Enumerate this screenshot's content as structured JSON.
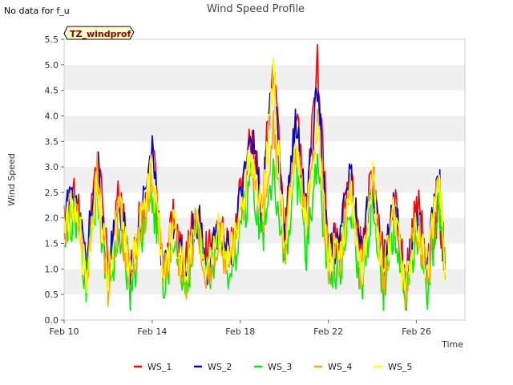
{
  "no_data_note": "No data for f_u",
  "chart_data": {
    "type": "line",
    "title": "Wind Speed Profile",
    "xlabel": "Time",
    "ylabel": "Wind Speed",
    "tag_label": "TZ_windprof",
    "x_start": "Feb 10",
    "x_end": "Feb 27.3",
    "xlim_days": [
      10,
      28.2
    ],
    "x_ticks": [
      {
        "day": 10,
        "label": "Feb 10"
      },
      {
        "day": 14,
        "label": "Feb 14"
      },
      {
        "day": 18,
        "label": "Feb 18"
      },
      {
        "day": 22,
        "label": "Feb 22"
      },
      {
        "day": 26,
        "label": "Feb 26"
      }
    ],
    "ylim": [
      0.0,
      5.5
    ],
    "y_ticks": [
      "0.0",
      "0.5",
      "1.0",
      "1.5",
      "2.0",
      "2.5",
      "3.0",
      "3.5",
      "4.0",
      "4.5",
      "5.0",
      "5.5"
    ],
    "grid": "horizontal bands",
    "legend_position": "bottom",
    "base_series_days": [
      10.0,
      10.5,
      11.0,
      11.5,
      12.0,
      12.5,
      13.0,
      13.5,
      14.0,
      14.5,
      15.0,
      15.5,
      16.0,
      16.5,
      17.0,
      17.5,
      18.0,
      18.5,
      19.0,
      19.5,
      20.0,
      20.5,
      21.0,
      21.5,
      22.0,
      22.5,
      23.0,
      23.5,
      24.0,
      24.5,
      25.0,
      25.5,
      26.0,
      26.5,
      27.0,
      27.3
    ],
    "series": [
      {
        "name": "WS_1",
        "color": "#ff0000",
        "values": [
          1.9,
          2.6,
          1.2,
          3.2,
          1.0,
          2.5,
          1.1,
          2.1,
          3.3,
          1.2,
          2.0,
          1.0,
          2.2,
          1.2,
          1.9,
          1.4,
          2.4,
          3.7,
          2.2,
          5.3,
          1.6,
          4.1,
          2.2,
          5.2,
          1.5,
          1.6,
          2.9,
          1.3,
          2.9,
          1.1,
          2.3,
          0.7,
          2.4,
          1.0,
          2.3,
          1.1
        ]
      },
      {
        "name": "WS_2",
        "color": "#0000dd",
        "values": [
          2.0,
          2.5,
          1.1,
          3.1,
          0.9,
          2.4,
          1.0,
          2.0,
          3.2,
          1.1,
          1.9,
          0.9,
          2.1,
          1.1,
          1.8,
          1.3,
          2.3,
          3.6,
          2.1,
          4.9,
          1.5,
          4.0,
          2.1,
          4.6,
          1.4,
          1.5,
          2.8,
          1.2,
          2.8,
          1.0,
          2.4,
          0.6,
          2.2,
          0.9,
          3.1,
          1.0
        ]
      },
      {
        "name": "WS_3",
        "color": "#00ee00",
        "values": [
          1.6,
          2.1,
          0.7,
          2.6,
          0.5,
          1.8,
          0.6,
          1.5,
          2.5,
          0.7,
          1.4,
          0.5,
          1.6,
          0.7,
          1.4,
          0.8,
          1.7,
          2.8,
          1.6,
          3.1,
          1.1,
          3.0,
          1.4,
          3.3,
          0.8,
          1.0,
          2.2,
          0.6,
          2.3,
          0.5,
          1.9,
          0.3,
          1.8,
          0.5,
          2.5,
          0.8
        ]
      },
      {
        "name": "WS_4",
        "color": "#ffa500",
        "values": [
          1.8,
          2.3,
          0.9,
          2.9,
          0.7,
          2.1,
          0.8,
          1.8,
          2.8,
          0.9,
          1.7,
          0.7,
          1.9,
          0.9,
          1.6,
          1.0,
          2.0,
          3.2,
          1.9,
          3.9,
          1.3,
          3.4,
          1.8,
          3.9,
          1.1,
          1.2,
          2.5,
          0.8,
          2.6,
          0.7,
          2.1,
          0.4,
          2.0,
          0.7,
          2.8,
          0.9
        ]
      },
      {
        "name": "WS_5",
        "color": "#ffff00",
        "values": [
          1.7,
          2.4,
          0.8,
          2.7,
          0.8,
          2.2,
          0.9,
          1.9,
          2.9,
          1.0,
          1.8,
          0.8,
          2.0,
          0.8,
          1.7,
          1.1,
          2.1,
          3.3,
          2.0,
          4.8,
          1.4,
          3.6,
          1.9,
          4.0,
          1.2,
          1.3,
          2.6,
          0.9,
          2.7,
          0.8,
          2.2,
          0.5,
          2.1,
          0.8,
          2.9,
          1.0
        ]
      }
    ]
  }
}
